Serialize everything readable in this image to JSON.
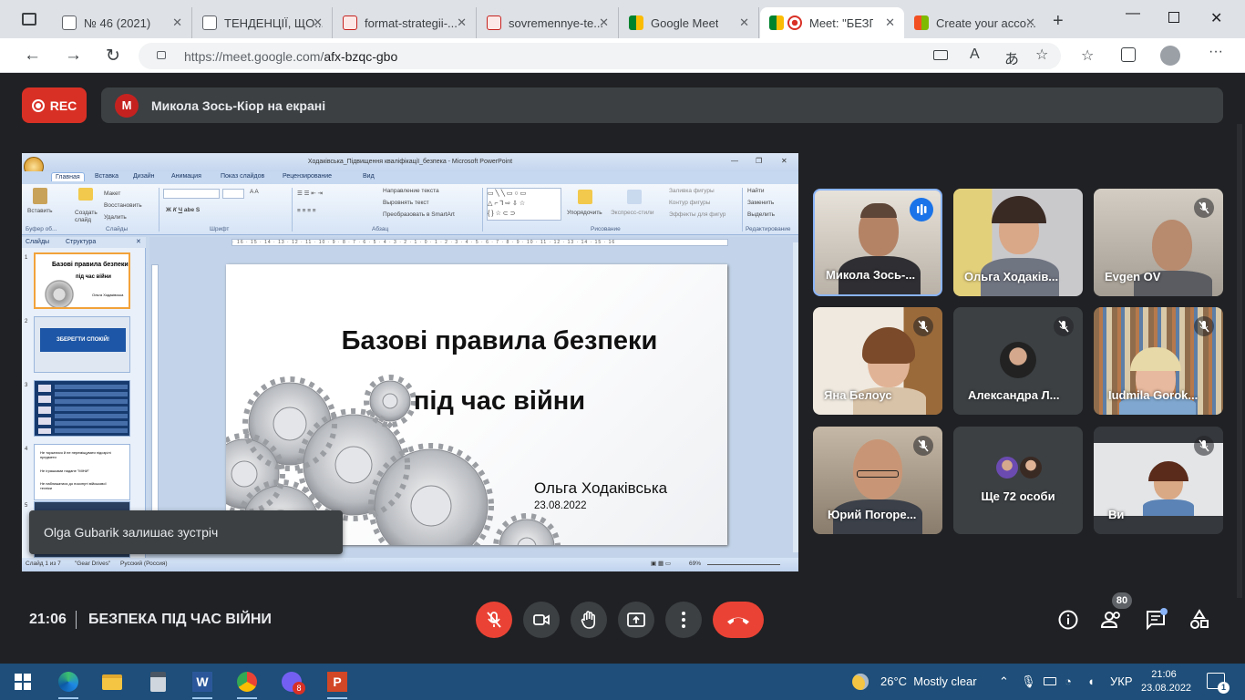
{
  "browser": {
    "tabs": [
      {
        "label": "№ 46 (2021)"
      },
      {
        "label": "ТЕНДЕНЦІЇ, ЩО..."
      },
      {
        "label": "format-strategii-..."
      },
      {
        "label": "sovremennye-te..."
      },
      {
        "label": "Google Meet"
      },
      {
        "label": "Meet: \"БЕЗП..."
      },
      {
        "label": "Create your acco..."
      }
    ],
    "url_host": "https://meet.google.com/",
    "url_path": "afx-bzqc-gbo"
  },
  "meet": {
    "rec_label": "REC",
    "presenter_initial": "M",
    "presenter_text": "Микола Зось-Кіор на екрані",
    "toast": "Olga Gubarik залишає зустріч",
    "time": "21:06",
    "meeting_title": "БЕЗПЕКА ПІД ЧАС ВІЙНИ",
    "participants_count": "80",
    "colors": {
      "accent": "#1a73e8",
      "danger": "#ea4335",
      "surface": "#3c4043",
      "background": "#202124"
    }
  },
  "powerpoint": {
    "window_title": "Ходаківська_Підвищення кваліфікації_безпека - Microsoft PowerPoint",
    "ribbon_tabs": [
      "Главная",
      "Вставка",
      "Дизайн",
      "Анимация",
      "Показ слайдов",
      "Рецензирование",
      "Вид"
    ],
    "groups": [
      "Буфер об...",
      "Слайды",
      "Шрифт",
      "Абзац",
      "Рисование",
      "Редактирование"
    ],
    "buttons": {
      "paste": "Вставить",
      "create_slide": "Создать слайд",
      "layout": "Макет",
      "restore": "Восстановить",
      "delete": "Удалить",
      "text_direction": "Направление текста",
      "align_text": "Выровнять текст",
      "smartart": "Преобразовать в SmartArt",
      "arrange": "Упорядочить",
      "quick_styles": "Экспресс-стили",
      "shape_fill": "Заливка фигуры",
      "shape_outline": "Контур фигуры",
      "shape_effects": "Эффекты для фигур",
      "find": "Найти",
      "replace": "Заменить",
      "select": "Выделить"
    },
    "pane_tabs": [
      "Слайды",
      "Структура"
    ],
    "thumb1_title": "Базові правила безпеки",
    "thumb1_sub": "під час війни",
    "thumb1_author": "Ольга Ходаківська",
    "thumb2_text": "ЗБЕРЕГТИ СПОКІЙ!",
    "thumb4_lines": [
      "Не торкатися й не переміщувати підозрілі предмети",
      "Не іграшками надане \"МІНИ\"",
      "Не наближатися до посинуті військової техніки"
    ],
    "slide_title_line1": "Базові правила безпеки",
    "slide_title_line2": "під час війни",
    "slide_author": "Ольга Ходаківська",
    "slide_date": "23.08.2022",
    "status_slide": "Слайд 1 из 7",
    "status_theme": "\"Gear Drives\"",
    "status_lang": "Русский (Россия)",
    "status_zoom": "69%"
  },
  "participants": [
    {
      "name": "Микола Зось-...",
      "speaking": true
    },
    {
      "name": "Ольга Ходаків...",
      "speaking": false
    },
    {
      "name": "Evgen OV",
      "muted": true
    },
    {
      "name": "Яна Белоус",
      "muted": true
    },
    {
      "name": "Александра Л...",
      "muted": true
    },
    {
      "name": "Iudmila Gorok...",
      "muted": true
    },
    {
      "name": "Юрий Погоре...",
      "muted": true
    },
    {
      "name": "Ще 72 особи"
    },
    {
      "name": "Ви",
      "muted": true
    }
  ],
  "taskbar": {
    "weather": "26°C  Mostly clear",
    "lang": "УКР",
    "time": "21:06",
    "date": "23.08.2022",
    "viber_badge": "8",
    "notif_badge": "1"
  }
}
